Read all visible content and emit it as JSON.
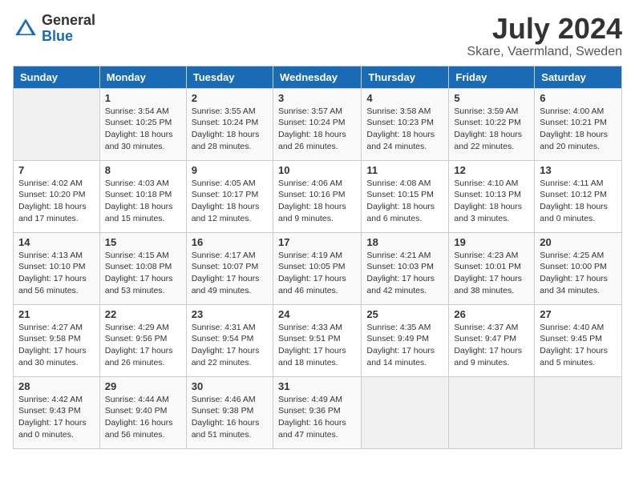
{
  "header": {
    "logo_general": "General",
    "logo_blue": "Blue",
    "month_year": "July 2024",
    "location": "Skare, Vaermland, Sweden"
  },
  "columns": [
    "Sunday",
    "Monday",
    "Tuesday",
    "Wednesday",
    "Thursday",
    "Friday",
    "Saturday"
  ],
  "weeks": [
    [
      {
        "day": "",
        "info": ""
      },
      {
        "day": "1",
        "info": "Sunrise: 3:54 AM\nSunset: 10:25 PM\nDaylight: 18 hours\nand 30 minutes."
      },
      {
        "day": "2",
        "info": "Sunrise: 3:55 AM\nSunset: 10:24 PM\nDaylight: 18 hours\nand 28 minutes."
      },
      {
        "day": "3",
        "info": "Sunrise: 3:57 AM\nSunset: 10:24 PM\nDaylight: 18 hours\nand 26 minutes."
      },
      {
        "day": "4",
        "info": "Sunrise: 3:58 AM\nSunset: 10:23 PM\nDaylight: 18 hours\nand 24 minutes."
      },
      {
        "day": "5",
        "info": "Sunrise: 3:59 AM\nSunset: 10:22 PM\nDaylight: 18 hours\nand 22 minutes."
      },
      {
        "day": "6",
        "info": "Sunrise: 4:00 AM\nSunset: 10:21 PM\nDaylight: 18 hours\nand 20 minutes."
      }
    ],
    [
      {
        "day": "7",
        "info": "Sunrise: 4:02 AM\nSunset: 10:20 PM\nDaylight: 18 hours\nand 17 minutes."
      },
      {
        "day": "8",
        "info": "Sunrise: 4:03 AM\nSunset: 10:18 PM\nDaylight: 18 hours\nand 15 minutes."
      },
      {
        "day": "9",
        "info": "Sunrise: 4:05 AM\nSunset: 10:17 PM\nDaylight: 18 hours\nand 12 minutes."
      },
      {
        "day": "10",
        "info": "Sunrise: 4:06 AM\nSunset: 10:16 PM\nDaylight: 18 hours\nand 9 minutes."
      },
      {
        "day": "11",
        "info": "Sunrise: 4:08 AM\nSunset: 10:15 PM\nDaylight: 18 hours\nand 6 minutes."
      },
      {
        "day": "12",
        "info": "Sunrise: 4:10 AM\nSunset: 10:13 PM\nDaylight: 18 hours\nand 3 minutes."
      },
      {
        "day": "13",
        "info": "Sunrise: 4:11 AM\nSunset: 10:12 PM\nDaylight: 18 hours\nand 0 minutes."
      }
    ],
    [
      {
        "day": "14",
        "info": "Sunrise: 4:13 AM\nSunset: 10:10 PM\nDaylight: 17 hours\nand 56 minutes."
      },
      {
        "day": "15",
        "info": "Sunrise: 4:15 AM\nSunset: 10:08 PM\nDaylight: 17 hours\nand 53 minutes."
      },
      {
        "day": "16",
        "info": "Sunrise: 4:17 AM\nSunset: 10:07 PM\nDaylight: 17 hours\nand 49 minutes."
      },
      {
        "day": "17",
        "info": "Sunrise: 4:19 AM\nSunset: 10:05 PM\nDaylight: 17 hours\nand 46 minutes."
      },
      {
        "day": "18",
        "info": "Sunrise: 4:21 AM\nSunset: 10:03 PM\nDaylight: 17 hours\nand 42 minutes."
      },
      {
        "day": "19",
        "info": "Sunrise: 4:23 AM\nSunset: 10:01 PM\nDaylight: 17 hours\nand 38 minutes."
      },
      {
        "day": "20",
        "info": "Sunrise: 4:25 AM\nSunset: 10:00 PM\nDaylight: 17 hours\nand 34 minutes."
      }
    ],
    [
      {
        "day": "21",
        "info": "Sunrise: 4:27 AM\nSunset: 9:58 PM\nDaylight: 17 hours\nand 30 minutes."
      },
      {
        "day": "22",
        "info": "Sunrise: 4:29 AM\nSunset: 9:56 PM\nDaylight: 17 hours\nand 26 minutes."
      },
      {
        "day": "23",
        "info": "Sunrise: 4:31 AM\nSunset: 9:54 PM\nDaylight: 17 hours\nand 22 minutes."
      },
      {
        "day": "24",
        "info": "Sunrise: 4:33 AM\nSunset: 9:51 PM\nDaylight: 17 hours\nand 18 minutes."
      },
      {
        "day": "25",
        "info": "Sunrise: 4:35 AM\nSunset: 9:49 PM\nDaylight: 17 hours\nand 14 minutes."
      },
      {
        "day": "26",
        "info": "Sunrise: 4:37 AM\nSunset: 9:47 PM\nDaylight: 17 hours\nand 9 minutes."
      },
      {
        "day": "27",
        "info": "Sunrise: 4:40 AM\nSunset: 9:45 PM\nDaylight: 17 hours\nand 5 minutes."
      }
    ],
    [
      {
        "day": "28",
        "info": "Sunrise: 4:42 AM\nSunset: 9:43 PM\nDaylight: 17 hours\nand 0 minutes."
      },
      {
        "day": "29",
        "info": "Sunrise: 4:44 AM\nSunset: 9:40 PM\nDaylight: 16 hours\nand 56 minutes."
      },
      {
        "day": "30",
        "info": "Sunrise: 4:46 AM\nSunset: 9:38 PM\nDaylight: 16 hours\nand 51 minutes."
      },
      {
        "day": "31",
        "info": "Sunrise: 4:49 AM\nSunset: 9:36 PM\nDaylight: 16 hours\nand 47 minutes."
      },
      {
        "day": "",
        "info": ""
      },
      {
        "day": "",
        "info": ""
      },
      {
        "day": "",
        "info": ""
      }
    ]
  ]
}
